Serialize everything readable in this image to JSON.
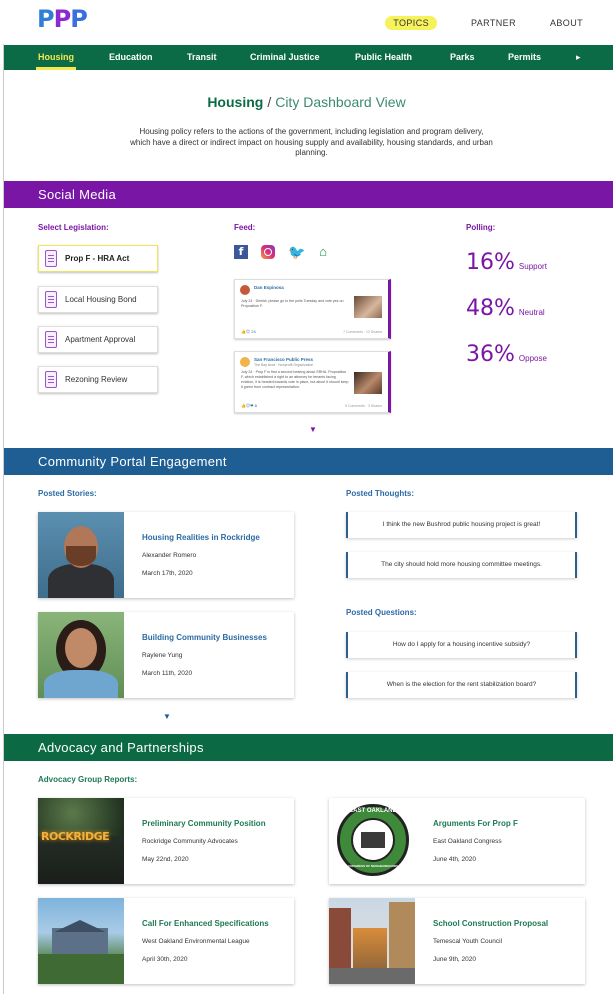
{
  "logo": "PPP",
  "toplinks": [
    {
      "label": "TOPICS",
      "active": true
    },
    {
      "label": "PARTNER",
      "active": false
    },
    {
      "label": "ABOUT",
      "active": false
    }
  ],
  "nav": [
    {
      "label": "Housing",
      "active": true
    },
    {
      "label": "Education"
    },
    {
      "label": "Transit"
    },
    {
      "label": "Criminal Justice"
    },
    {
      "label": "Public Health"
    },
    {
      "label": "Parks"
    },
    {
      "label": "Permits"
    },
    {
      "label": "▸"
    }
  ],
  "hero": {
    "topic": "Housing",
    "separator": "/",
    "view": "City Dashboard View",
    "intro": "Housing policy refers to the actions of the government, including legislation and program delivery, which have a direct or indirect impact on housing supply and availability, housing standards, and urban planning."
  },
  "social": {
    "title": "Social Media",
    "select_label": "Select Legislation:",
    "legislation": [
      "Prop F - HRA Act",
      "Local Housing Bond",
      "Apartment Approval",
      "Rezoning Review"
    ],
    "feed_label": "Feed:",
    "icons": [
      "facebook-icon",
      "instagram-icon",
      "twitter-icon",
      "nextdoor-icon"
    ],
    "posts": [
      {
        "name": "Dan Espinosa",
        "text": "July 24 · District: please go to the polls Tuesday and vote yes on Proposition F.",
        "reactions": "👍😊 24",
        "meta": "7 Comments · 12 Shares"
      },
      {
        "name": "San Francisco Public Press",
        "sub": "The Bay Area · Nonprofit Organization",
        "text": "July 24 · Prop F is first a second hearing about SRHA. Proposition F, which established a right to an attorney for tenants facing eviction, it is headed towards vote in place, but about it should keep it green from contract representation.",
        "reactions": "👍😊❤ 8",
        "meta": "6 Comments · 3 Shares"
      }
    ],
    "polling_label": "Polling:",
    "polling": [
      {
        "value": 16,
        "pct": "16%",
        "label": "Support"
      },
      {
        "value": 48,
        "pct": "48%",
        "label": "Neutral"
      },
      {
        "value": 36,
        "pct": "36%",
        "label": "Oppose"
      }
    ],
    "more": "▼"
  },
  "community": {
    "title": "Community Portal Engagement",
    "stories_label": "Posted Stories:",
    "stories": [
      {
        "title": "Housing Realities in Rockridge",
        "author": "Alexander Romero",
        "date": "March 17th, 2020"
      },
      {
        "title": "Building Community Businesses",
        "author": "Raylene Yung",
        "date": "March 11th, 2020"
      }
    ],
    "thoughts_label": "Posted Thoughts:",
    "thoughts": [
      "I think the new Bushrod public housing project is great!",
      "The city should hold more housing committee meetings."
    ],
    "questions_label": "Posted Questions:",
    "questions": [
      "How do I apply for a housing incentive subsidy?",
      "When is the election for the rent stabilization board?"
    ],
    "more": "▼"
  },
  "advocacy": {
    "title": "Advocacy and Partnerships",
    "reports_label": "Advocacy Group Reports:",
    "reports": [
      {
        "title": "Preliminary Community Position",
        "org": "Rockridge Community Advocates",
        "date": "May 22nd, 2020"
      },
      {
        "title": "Arguments For Prop F",
        "org": "East Oakland Congress",
        "date": "June 4th, 2020"
      },
      {
        "title": "Call For Enhanced Specifications",
        "org": "West Oakland Environmental League",
        "date": "April 30th, 2020"
      },
      {
        "title": "School Construction Proposal",
        "org": "Temescal Youth Council",
        "date": "June 9th, 2020"
      }
    ],
    "logo_text_top": "EAST OAKLAND",
    "logo_text_bottom": "CONGRESS OF NEIGHBORHOODS",
    "sign_text": "ROCKRIDGE"
  }
}
